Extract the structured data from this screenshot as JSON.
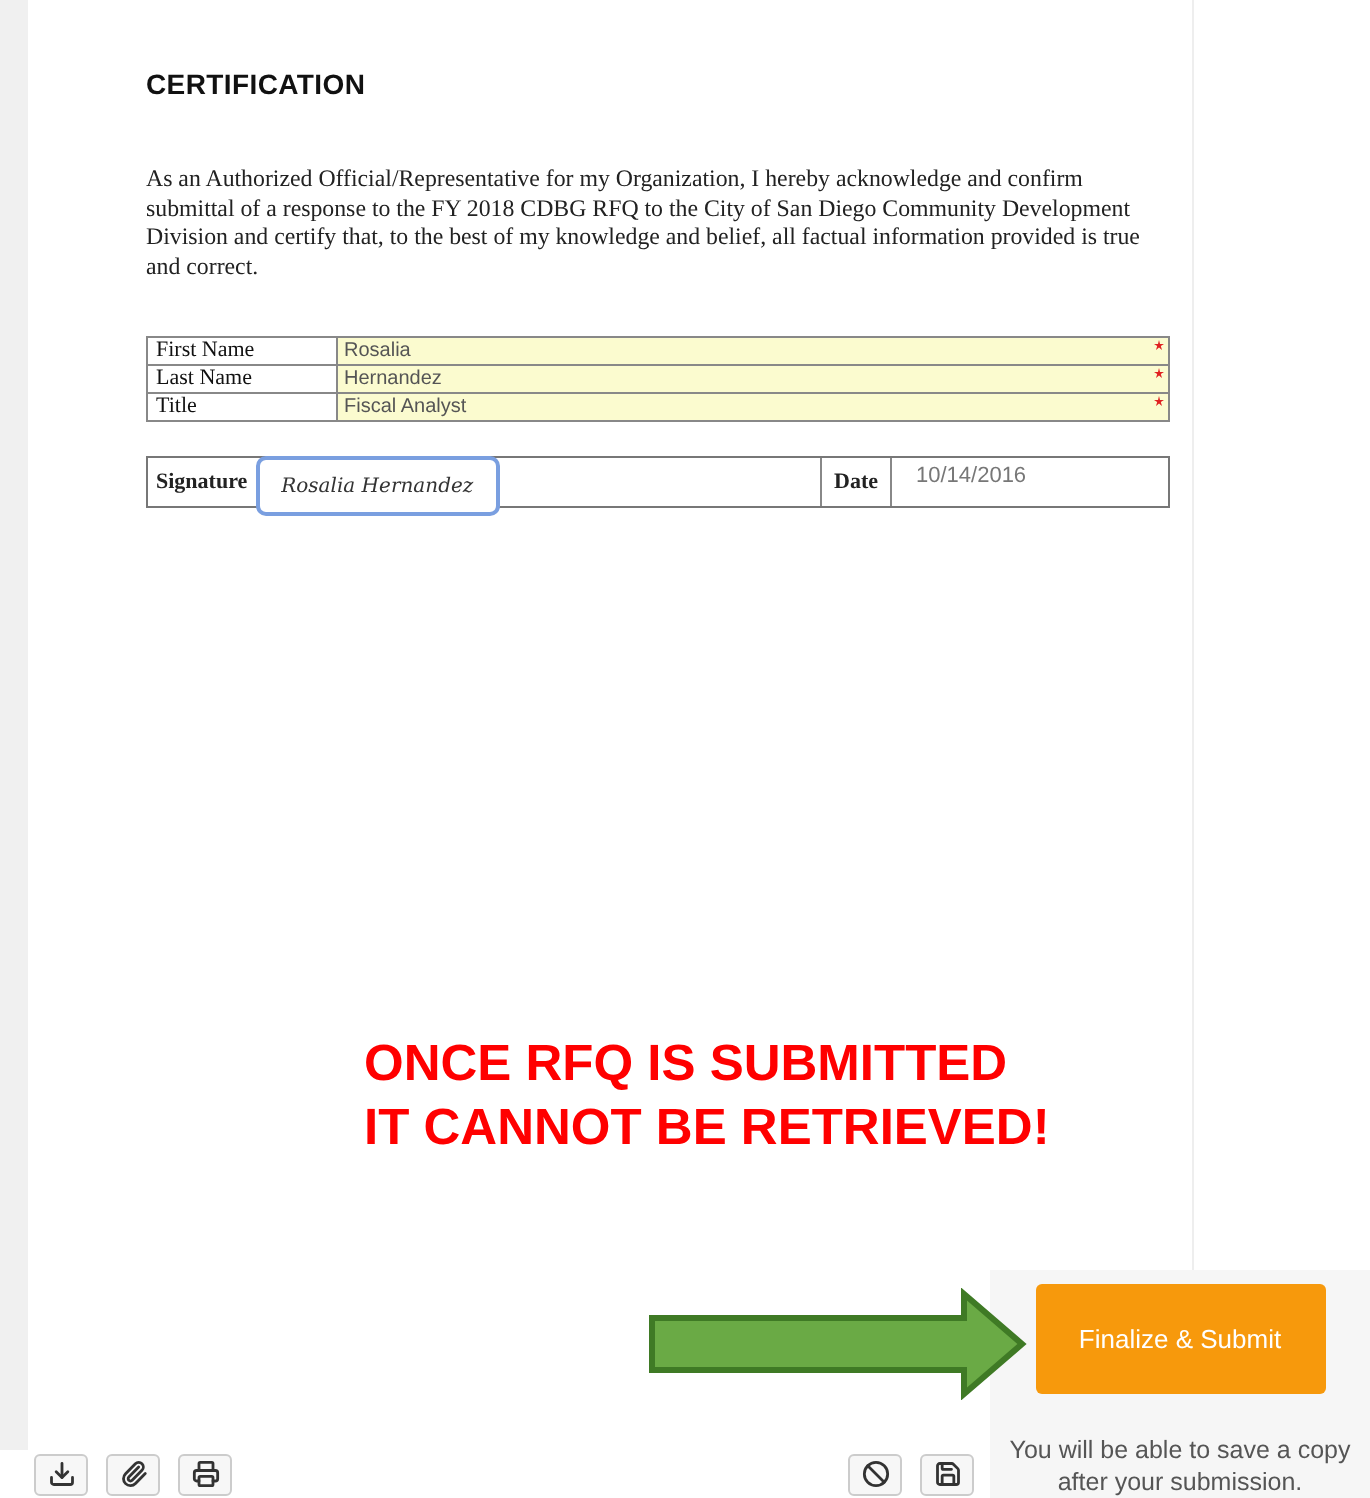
{
  "document": {
    "heading": "CERTIFICATION",
    "paragraph": "As an Authorized Official/Representative for my Organization, I hereby acknowledge and confirm submittal of a response to the FY 2018 CDBG RFQ to the City of San Diego Community Development Division and certify that, to the best of my knowledge and belief, all factual information provided is true and correct.",
    "fields": [
      {
        "label": "First Name",
        "value": "Rosalia",
        "required": true
      },
      {
        "label": "Last Name",
        "value": "Hernandez",
        "required": true
      },
      {
        "label": "Title",
        "value": "Fiscal Analyst",
        "required": true
      }
    ],
    "signature": {
      "label": "Signature",
      "value": "Rosalia Hernandez"
    },
    "date": {
      "label": "Date",
      "value": "10/14/2016"
    }
  },
  "warning": [
    "ONCE RFQ IS SUBMITTED",
    "IT CANNOT BE RETRIEVED!"
  ],
  "toolbar": {
    "left": [
      {
        "kind": "download"
      },
      {
        "kind": "attach"
      },
      {
        "kind": "print"
      }
    ],
    "right": [
      {
        "kind": "cancel"
      },
      {
        "kind": "save"
      }
    ]
  },
  "submit_panel": {
    "button": "Finalize & Submit",
    "note": "You will be able to save a copy after your submission."
  }
}
